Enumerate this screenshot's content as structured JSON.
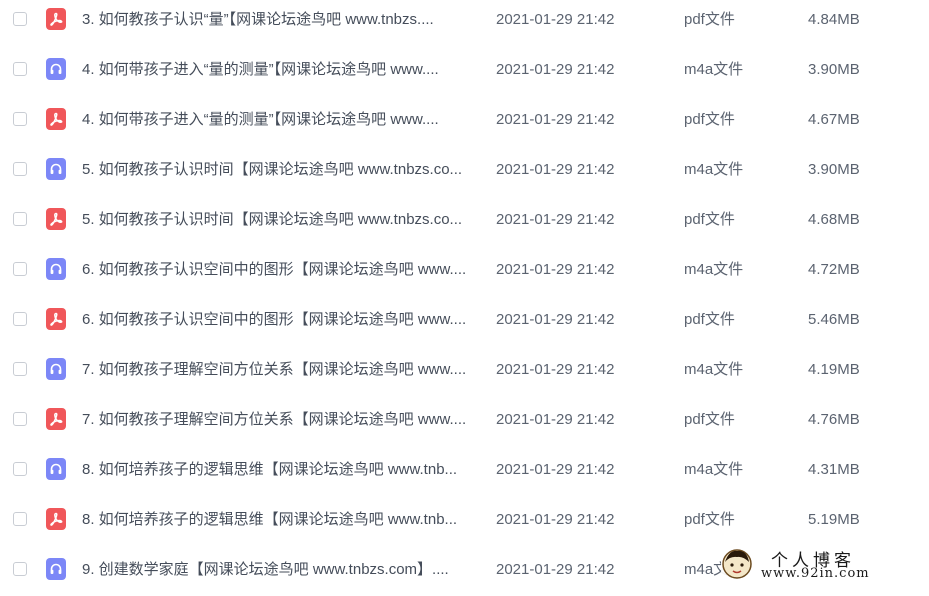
{
  "files": [
    {
      "name": "3. 如何教孩子认识“量”【网课论坛途鸟吧 www.tnbzs....",
      "date": "2021-01-29 21:42",
      "type": "pdf文件",
      "size": "4.84MB",
      "icon": "pdf-icon"
    },
    {
      "name": "4. 如何带孩子进入“量的测量”【网课论坛途鸟吧 www....",
      "date": "2021-01-29 21:42",
      "type": "m4a文件",
      "size": "3.90MB",
      "icon": "audio-icon"
    },
    {
      "name": "4. 如何带孩子进入“量的测量”【网课论坛途鸟吧 www....",
      "date": "2021-01-29 21:42",
      "type": "pdf文件",
      "size": "4.67MB",
      "icon": "pdf-icon"
    },
    {
      "name": "5. 如何教孩子认识时间【网课论坛途鸟吧 www.tnbzs.co...",
      "date": "2021-01-29 21:42",
      "type": "m4a文件",
      "size": "3.90MB",
      "icon": "audio-icon"
    },
    {
      "name": "5. 如何教孩子认识时间【网课论坛途鸟吧 www.tnbzs.co...",
      "date": "2021-01-29 21:42",
      "type": "pdf文件",
      "size": "4.68MB",
      "icon": "pdf-icon"
    },
    {
      "name": "6. 如何教孩子认识空间中的图形【网课论坛途鸟吧 www....",
      "date": "2021-01-29 21:42",
      "type": "m4a文件",
      "size": "4.72MB",
      "icon": "audio-icon"
    },
    {
      "name": "6. 如何教孩子认识空间中的图形【网课论坛途鸟吧 www....",
      "date": "2021-01-29 21:42",
      "type": "pdf文件",
      "size": "5.46MB",
      "icon": "pdf-icon"
    },
    {
      "name": "7. 如何教孩子理解空间方位关系【网课论坛途鸟吧 www....",
      "date": "2021-01-29 21:42",
      "type": "m4a文件",
      "size": "4.19MB",
      "icon": "audio-icon"
    },
    {
      "name": "7. 如何教孩子理解空间方位关系【网课论坛途鸟吧 www....",
      "date": "2021-01-29 21:42",
      "type": "pdf文件",
      "size": "4.76MB",
      "icon": "pdf-icon"
    },
    {
      "name": "8. 如何培养孩子的逻辑思维【网课论坛途鸟吧 www.tnb...",
      "date": "2021-01-29 21:42",
      "type": "m4a文件",
      "size": "4.31MB",
      "icon": "audio-icon"
    },
    {
      "name": "8. 如何培养孩子的逻辑思维【网课论坛途鸟吧 www.tnb...",
      "date": "2021-01-29 21:42",
      "type": "pdf文件",
      "size": "5.19MB",
      "icon": "pdf-icon"
    },
    {
      "name": "9. 创建数学家庭【网课论坛途鸟吧 www.tnbzs.com】....",
      "date": "2021-01-29 21:42",
      "type": "m4a文",
      "size": "",
      "icon": "audio-icon"
    }
  ],
  "watermark": {
    "title": "个人博客",
    "url": "www.92in.com"
  },
  "colors": {
    "pdf_icon": "#f0575a",
    "audio_icon": "#7c87f7",
    "text": "#454d5a"
  }
}
